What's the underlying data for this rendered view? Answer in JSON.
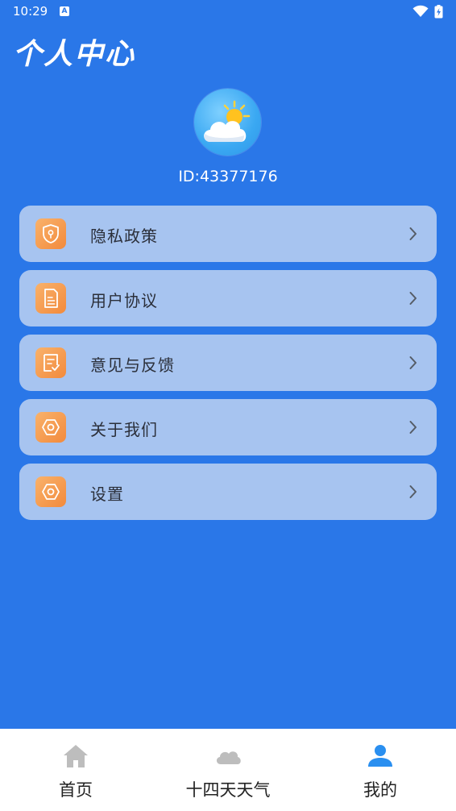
{
  "status_bar": {
    "time": "10:29",
    "notification_badge": "A"
  },
  "header": {
    "title": "个人中心"
  },
  "profile": {
    "user_id": "ID:43377176"
  },
  "menu": {
    "items": [
      {
        "label": "隐私政策",
        "icon": "shield-icon"
      },
      {
        "label": "用户协议",
        "icon": "document-icon"
      },
      {
        "label": "意见与反馈",
        "icon": "feedback-icon"
      },
      {
        "label": "关于我们",
        "icon": "hexagon-icon"
      },
      {
        "label": "设置",
        "icon": "settings-icon"
      }
    ]
  },
  "bottom_nav": {
    "tabs": [
      {
        "label": "首页",
        "icon": "home-icon",
        "active": false
      },
      {
        "label": "十四天天气",
        "icon": "cloud-icon",
        "active": false
      },
      {
        "label": "我的",
        "icon": "user-icon",
        "active": true
      }
    ]
  },
  "colors": {
    "background": "#2a77e8",
    "menu_item_bg": "#a7c4f0",
    "icon_gradient_start": "#f9b26b",
    "icon_gradient_end": "#f28a3c",
    "active_tab": "#2a8ff0",
    "inactive_tab_icon": "#bdbdbd"
  }
}
